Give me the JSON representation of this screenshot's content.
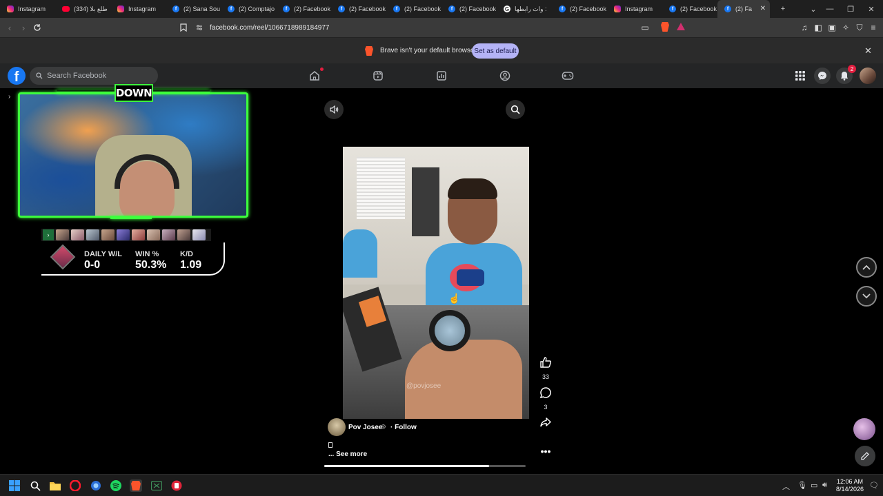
{
  "browser": {
    "tabs": [
      {
        "label": "Instagram",
        "icon": "instagram-icon",
        "active": false
      },
      {
        "label": "(334) طلع بلا",
        "icon": "youtube-icon",
        "active": false
      },
      {
        "label": "Instagram",
        "icon": "instagram-icon",
        "active": false
      },
      {
        "label": "(2) Sana Sou",
        "icon": "facebook-icon",
        "active": false
      },
      {
        "label": "(2) Comptajo",
        "icon": "facebook-icon",
        "active": false
      },
      {
        "label": "(2) Facebook",
        "icon": "facebook-icon",
        "active": false
      },
      {
        "label": "(2) Facebook",
        "icon": "facebook-icon",
        "active": false
      },
      {
        "label": "(2) Facebook",
        "icon": "facebook-icon",
        "active": false
      },
      {
        "label": "(2) Facebook",
        "icon": "facebook-icon",
        "active": false
      },
      {
        "label": "وات رابطها :",
        "icon": "google-icon",
        "active": false
      },
      {
        "label": "(2) Facebook",
        "icon": "facebook-icon",
        "active": false
      },
      {
        "label": "Instagram",
        "icon": "instagram-icon",
        "active": false
      },
      {
        "label": "(2) Facebook",
        "icon": "facebook-icon",
        "active": false
      },
      {
        "label": "(2) Fa",
        "icon": "facebook-icon",
        "active": true
      }
    ],
    "url": "facebook.com/reel/1066718989184977",
    "notification": {
      "message": "Brave isn't your default browser",
      "button": "Set as default"
    }
  },
  "facebook": {
    "search_placeholder": "Search Facebook",
    "notification_count": "2",
    "accent": "#1877f2"
  },
  "stream_overlay": {
    "badge": "DOWN",
    "stats": [
      {
        "label": "DAILY W/L",
        "value": "0-0"
      },
      {
        "label": "WIN %",
        "value": "50.3%"
      },
      {
        "label": "K/D",
        "value": "1.09"
      }
    ]
  },
  "reel": {
    "watermark": "@povjosee",
    "likes": "33",
    "comments": "3",
    "author": "Pov Josee",
    "follow": "· Follow",
    "see_more": "... See more",
    "progress_fraction": 0.82
  },
  "taskbar": {
    "time": "12:06 AM",
    "date": "8/14/2026"
  }
}
